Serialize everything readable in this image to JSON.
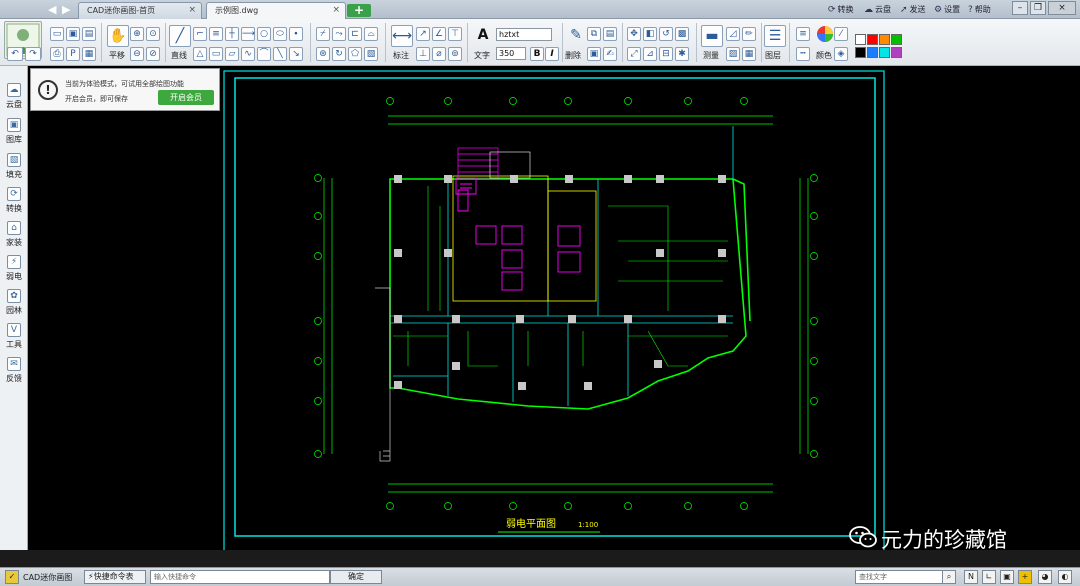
{
  "tabs": {
    "home": "CAD迷你画图-首页",
    "drawing": "示例图.dwg",
    "close_glyph": "×",
    "add_glyph": "+"
  },
  "top_links": {
    "convert": "转换",
    "cloud": "云盘",
    "send": "发送",
    "settings": "设置",
    "help": "帮助"
  },
  "ribbon": {
    "pan": "平移",
    "line": "直线",
    "annotate": "标注",
    "text": "文字",
    "font_name": "hztxt",
    "font_size": "350",
    "bold": "B",
    "italic": "I",
    "delete": "删除",
    "measure": "测量",
    "layer": "图层",
    "color": "颜色",
    "text_glyph": "A"
  },
  "left_tools": [
    {
      "label": "云盘"
    },
    {
      "label": "图库"
    },
    {
      "label": "填充"
    },
    {
      "label": "转换"
    },
    {
      "label": "家装"
    },
    {
      "label": "弱电"
    },
    {
      "label": "园林"
    },
    {
      "label": "工具"
    },
    {
      "label": "反馈"
    }
  ],
  "notice": {
    "line1": "当前为体验模式，可试用全部绘图功能",
    "line2": "开启会员，即可保存",
    "button": "开启会员",
    "glyph": "!"
  },
  "drawing": {
    "title": "弱电平面图",
    "scale": "1:100"
  },
  "status": {
    "app_name": "CAD迷你画图",
    "cmd_button": "⚡快捷命令表",
    "cmd_placeholder": "输入快捷命令",
    "ok": "确定",
    "find_placeholder": "查找文字"
  },
  "watermark": "元力的珍藏馆",
  "colors": {
    "cad_green": "#00ff00",
    "cad_cyan": "#00e5e5",
    "cad_magenta": "#ff00ff",
    "cad_yellow": "#ffff00",
    "member_green": "#3da83d"
  },
  "palette": [
    "#ffffff",
    "#ff0000",
    "#ff8c00",
    "#00c000",
    "#000000",
    "#1a7cff",
    "#00e5e5",
    "#b040c0"
  ]
}
